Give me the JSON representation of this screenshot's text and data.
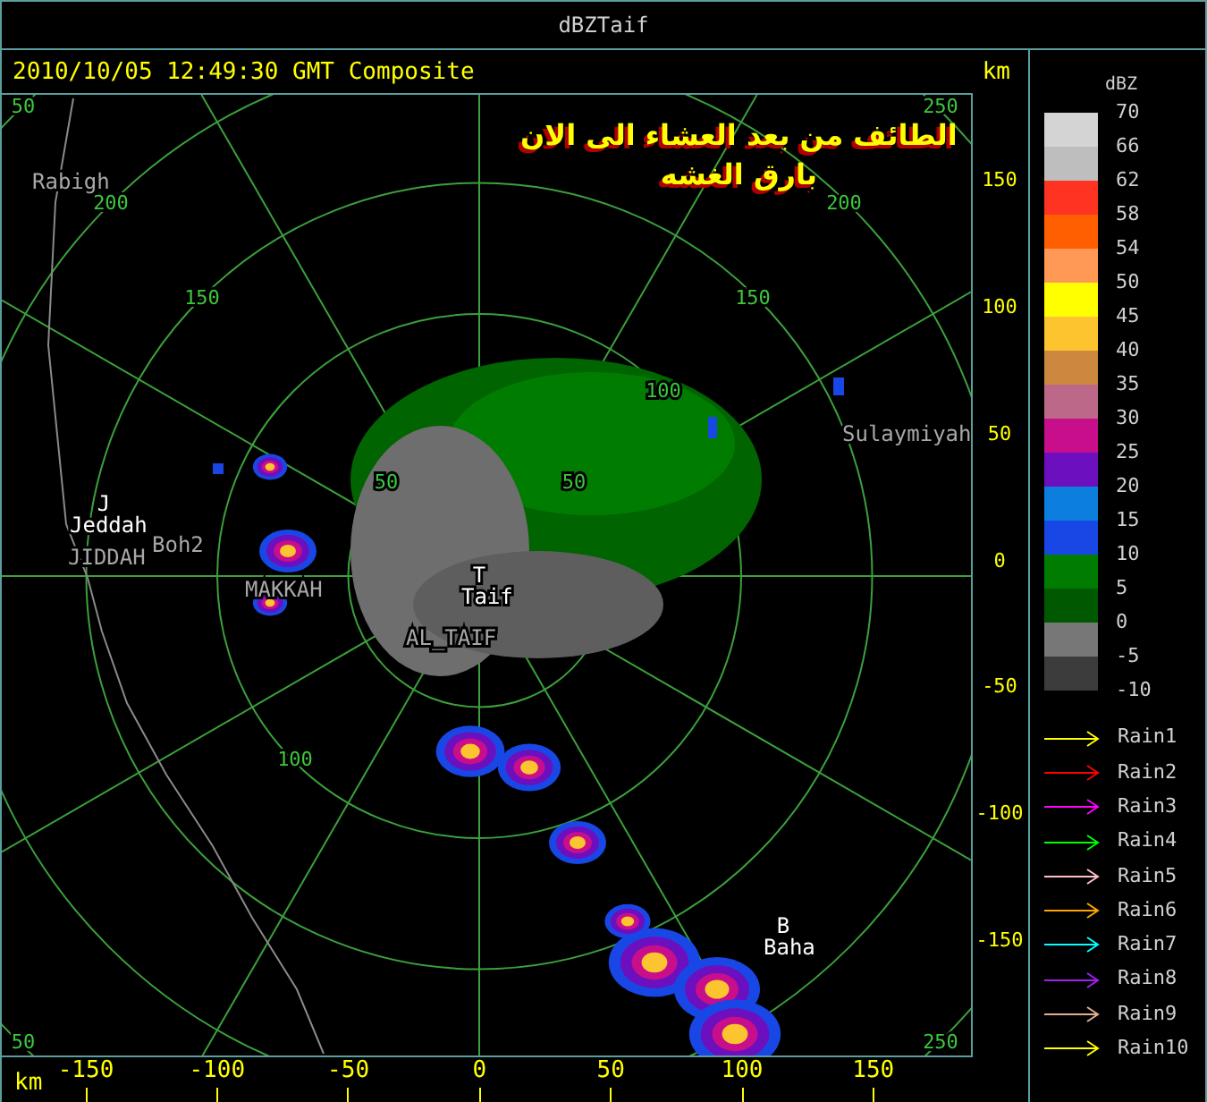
{
  "window": {
    "title": "dBZTaif"
  },
  "header": {
    "timestamp": "2010/10/05 12:49:30 GMT Composite",
    "unit": "km"
  },
  "overlay_text": [
    "الطائف من بعد العشاء الى الان",
    "بارق الغشه"
  ],
  "range_ring_labels": [
    "50",
    "250",
    "200",
    "200",
    "150",
    "150",
    "100",
    "50",
    "50",
    "100",
    "50",
    "250"
  ],
  "places": [
    {
      "kind": "place",
      "name": "Rabigh"
    },
    {
      "kind": "station",
      "marker": "J",
      "name": "Jeddah"
    },
    {
      "kind": "place",
      "name": "Boh2"
    },
    {
      "kind": "place",
      "name": "JIDDAH"
    },
    {
      "kind": "place",
      "name": "MAKKAH"
    },
    {
      "kind": "station",
      "marker": "T",
      "name": "Taif"
    },
    {
      "kind": "place",
      "name": "AL_TAIF"
    },
    {
      "kind": "place",
      "name": "Sulaymiyah"
    },
    {
      "kind": "station",
      "marker": "B",
      "name": "Baha"
    }
  ],
  "y_axis_labels": [
    "150",
    "100",
    "50",
    "0",
    "-50",
    "-100",
    "-150"
  ],
  "x_axis": {
    "unit": "km",
    "labels": [
      "-150",
      "-100",
      "-50",
      "0",
      "50",
      "100",
      "150"
    ]
  },
  "legend": {
    "unit": "dBZ",
    "labels": [
      "70",
      "66",
      "62",
      "58",
      "54",
      "50",
      "45",
      "40",
      "35",
      "30",
      "25",
      "20",
      "15",
      "10",
      "5",
      "0",
      "-5",
      "-10"
    ],
    "bands": [
      {
        "color": "#d4d4d4"
      },
      {
        "color": "#bebebe"
      },
      {
        "color": "#ff3322"
      },
      {
        "color": "#ff5f00"
      },
      {
        "color": "#ff9955"
      },
      {
        "color": "#ffff00"
      },
      {
        "color": "#fcc530"
      },
      {
        "color": "#cd8840"
      },
      {
        "color": "#bc6888"
      },
      {
        "color": "#c80e8a"
      },
      {
        "color": "#6c0fbe"
      },
      {
        "color": "#0b7ede"
      },
      {
        "color": "#1947e6"
      },
      {
        "color": "#007d00"
      },
      {
        "color": "#005800"
      },
      {
        "color": "#777777"
      },
      {
        "color": "#3c3c3c"
      }
    ]
  },
  "rain_legend": [
    {
      "label": "Rain1",
      "color": "#ffff00"
    },
    {
      "label": "Rain2",
      "color": "#ff0000"
    },
    {
      "label": "Rain3",
      "color": "#ff00ff"
    },
    {
      "label": "Rain4",
      "color": "#00ff00"
    },
    {
      "label": "Rain5",
      "color": "#ffc0cb"
    },
    {
      "label": "Rain6",
      "color": "#ffa500"
    },
    {
      "label": "Rain7",
      "color": "#00ffff"
    },
    {
      "label": "Rain8",
      "color": "#a020f0"
    },
    {
      "label": "Rain9",
      "color": "#e0b090"
    },
    {
      "label": "Rain10",
      "color": "#ffff00"
    }
  ]
}
